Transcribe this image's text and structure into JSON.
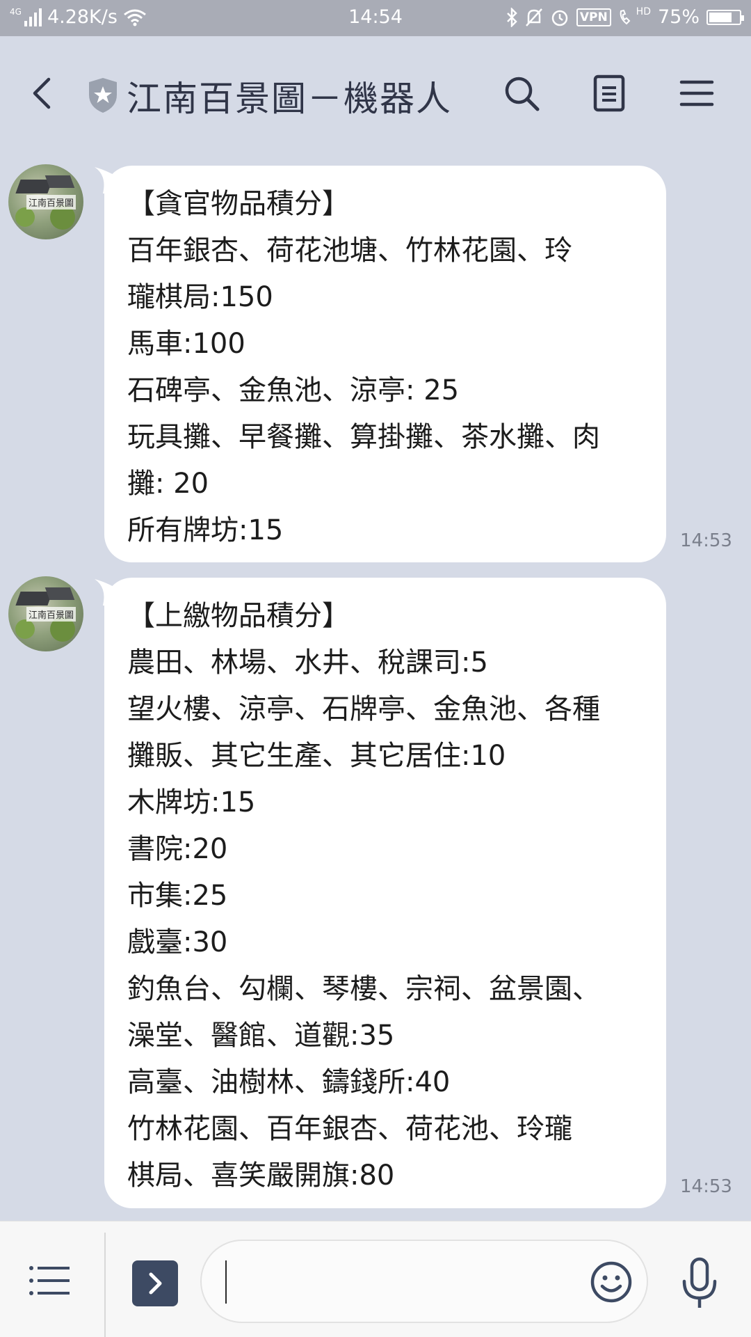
{
  "status_bar": {
    "network": "4G",
    "speed": "4.28K/s",
    "time": "14:54",
    "vpn_label": "VPN",
    "hd_label": "HD",
    "battery_text": "75%",
    "battery_level": 0.75
  },
  "header": {
    "title": "江南百景圖－機器人",
    "icons": [
      "back-arrow-icon",
      "shield-star-icon",
      "search-icon",
      "notes-icon",
      "hamburger-menu-icon"
    ]
  },
  "avatar": {
    "logo_text": "江南百景圖"
  },
  "messages": [
    {
      "time": "14:53",
      "lines": [
        "【貪官物品積分】",
        "百年銀杏、荷花池塘、竹林花園、玲",
        "瓏棋局:150",
        "馬車:100",
        "石碑亭、金魚池、涼亭: 25",
        "玩具攤、早餐攤、算掛攤、茶水攤、肉",
        "攤: 20",
        "所有牌坊:15"
      ]
    },
    {
      "time": "14:53",
      "lines": [
        "【上繳物品積分】",
        "農田、林場、水井、稅課司:5",
        "望火樓、涼亭、石牌亭、金魚池、各種",
        "攤販、其它生產、其它居住:10",
        "木牌坊:15",
        "書院:20",
        "市集:25",
        "戲臺:30",
        "釣魚台、勾欄、琴樓、宗祠、盆景園、",
        "澡堂、醫館、道觀:35",
        "高臺、油樹林、鑄錢所:40",
        "竹林花園、百年銀杏、荷花池、玲瓏",
        "棋局、喜笑嚴開旗:80"
      ]
    }
  ],
  "composer": {
    "input_value": ""
  },
  "colors": {
    "background": "#d5dae6",
    "bubble": "#ffffff",
    "header_text": "#303548",
    "expand_button": "#3d4a63"
  }
}
